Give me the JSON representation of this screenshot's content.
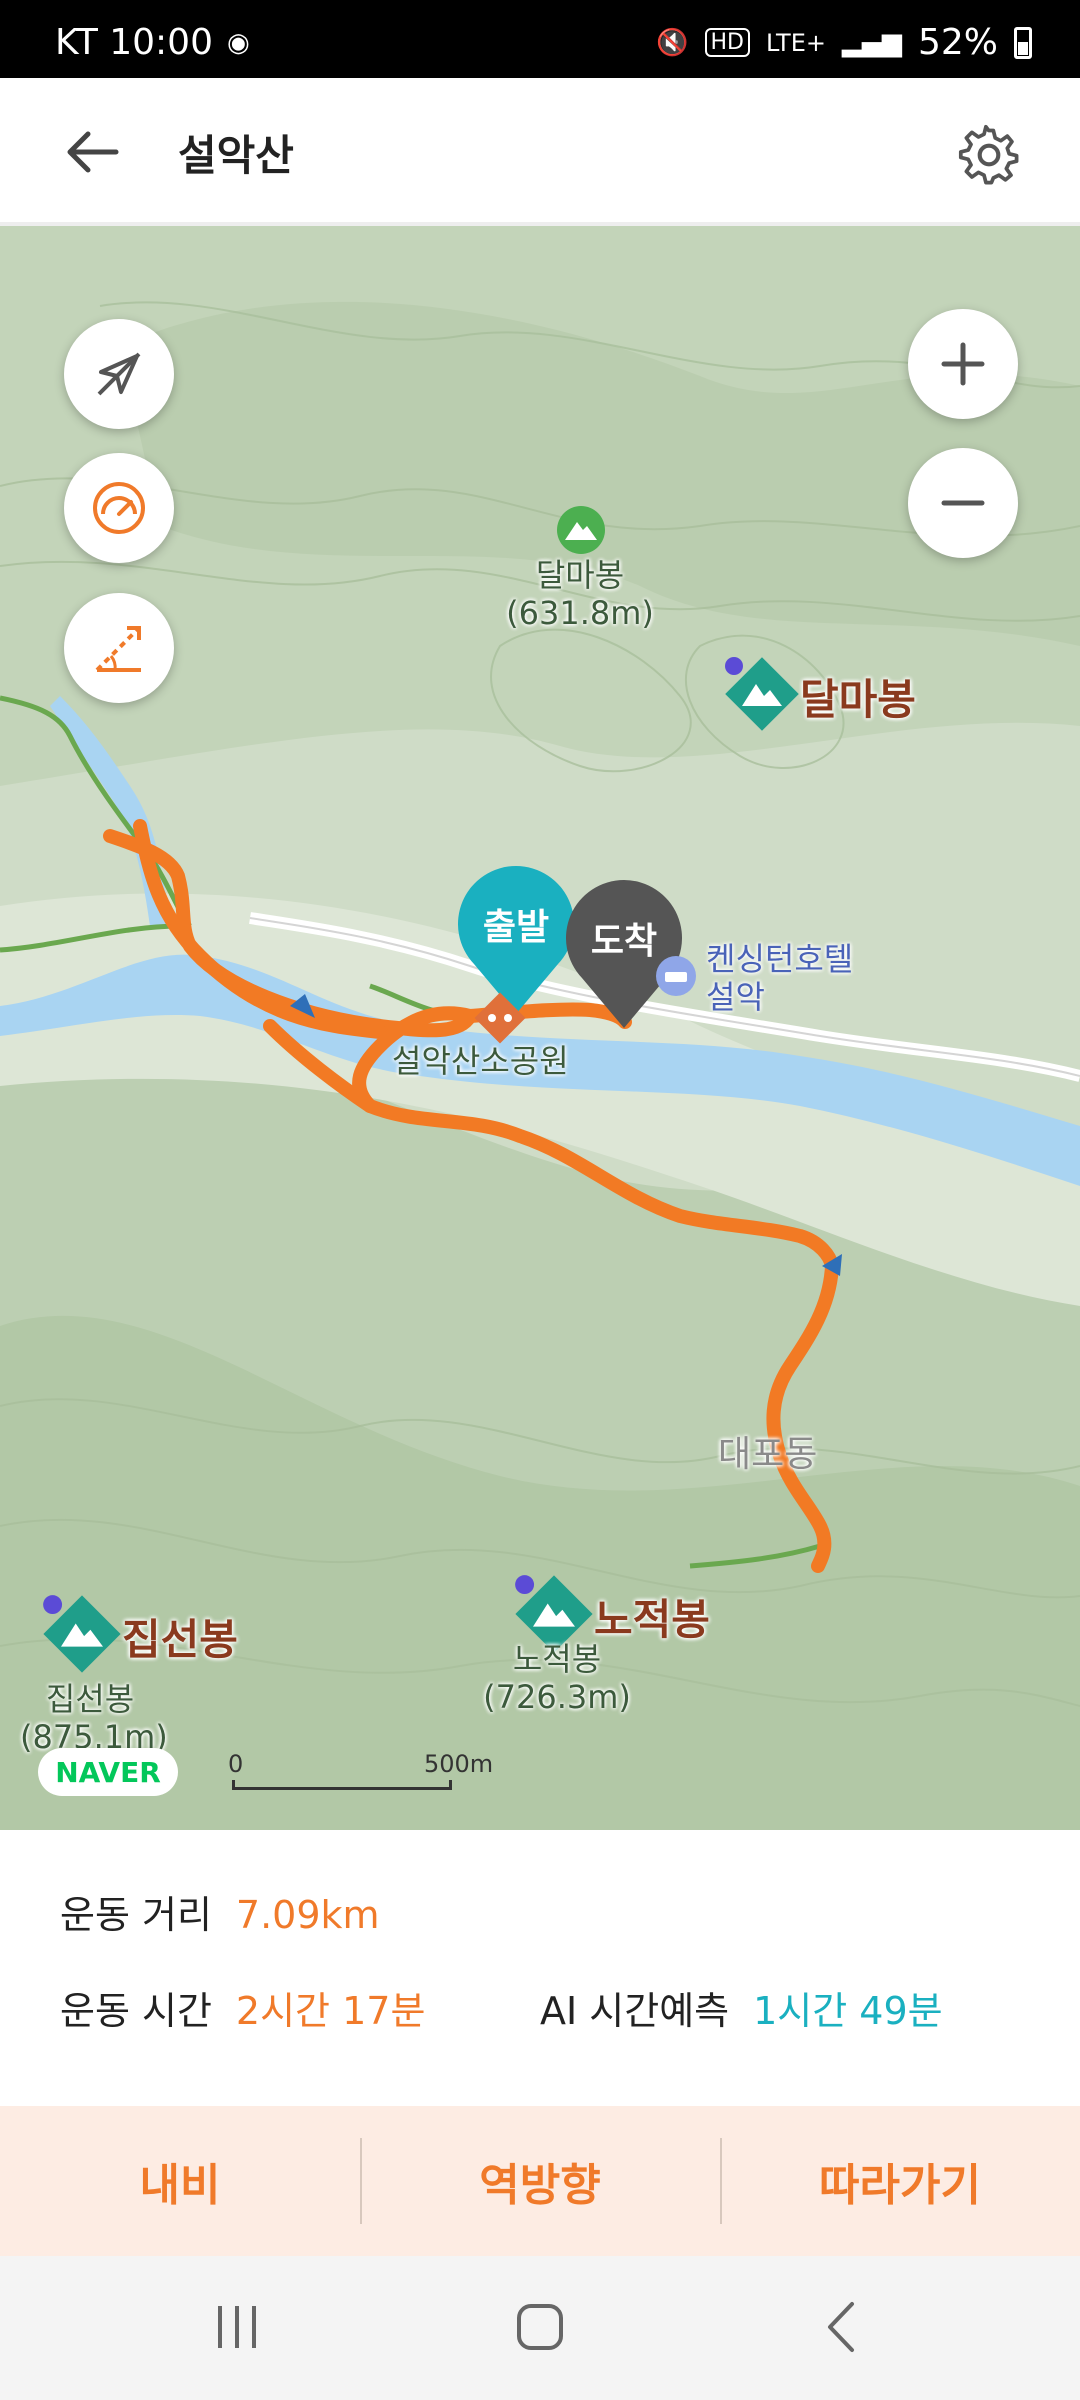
{
  "status_bar": {
    "carrier_time": "KT 10:00",
    "network": "LTE+",
    "battery": "52%"
  },
  "app_bar": {
    "title": "설악산"
  },
  "map": {
    "labels": {
      "dalmabong_small_name": "달마봉",
      "dalmabong_small_height": "(631.8m)",
      "dalmabong_peak": "달마봉",
      "start_pin": "출발",
      "end_pin": "도착",
      "hotel_line1": "켄싱턴호텔",
      "hotel_line2": "설악",
      "park": "설악산소공원",
      "daepodong": "대포동",
      "jipseonbong_peak": "집선봉",
      "jipseonbong_name": "집선봉",
      "jipseonbong_height": "(875.1m)",
      "nojeokbong_peak": "노적봉",
      "nojeokbong_name": "노적봉",
      "nojeokbong_height": "(726.3m)"
    },
    "naver_logo": "NAVER",
    "scale": {
      "start": "0",
      "end": "500m"
    },
    "colors": {
      "route": "#f27a24",
      "river": "#a9d4f2",
      "trail": "#6aa84f"
    }
  },
  "stats": {
    "distance_label": "운동 거리",
    "distance_value": "7.09km",
    "time_label": "운동 시간",
    "time_value": "2시간 17분",
    "ai_label": "AI 시간예측",
    "ai_value": "1시간 49분"
  },
  "actions": {
    "navi": "내비",
    "reverse": "역방향",
    "follow": "따라가기"
  }
}
